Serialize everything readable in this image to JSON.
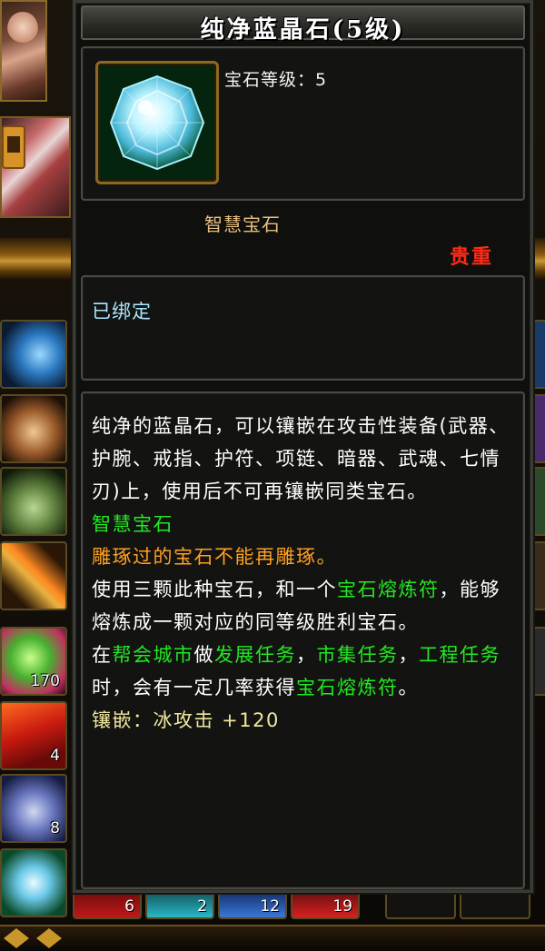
{
  "item": {
    "title": "纯净蓝晶石(5级)",
    "level_text": "宝石等级：5",
    "gem_type": "智慧宝石",
    "rarity": "贵重",
    "bound": "已绑定",
    "icon": "blue-crystal-gem-icon"
  },
  "description": {
    "p1": "纯净的蓝晶石，可以镶嵌在攻击性装备(武器、护腕、戒指、护符、项链、暗器、武魂、七情刃)上，使用后不可再镶嵌同类宝石。",
    "type_line": "智慧宝石",
    "warning": "雕琢过的宝石不能再雕琢。",
    "p3_a": "使用三颗此种宝石，和一个",
    "p3_link": "宝石熔炼符",
    "p3_b": "，能够熔炼成一颗对应的同等级胜利宝石。",
    "p4_a": "在",
    "p4_city": "帮会城市",
    "p4_b": "做",
    "p4_task1": "发展任务",
    "p4_c": "，",
    "p4_task2": "市集任务",
    "p4_d": "，",
    "p4_task3": "工程任务",
    "p4_e": "时，会有一定几率获得",
    "p4_reward": "宝石熔炼符",
    "p4_f": "。",
    "inlay_label": "镶嵌：",
    "inlay_value": "冰攻击 +120"
  },
  "background": {
    "inventory_counts": [
      "170",
      "4",
      "8"
    ],
    "bottom_counts": [
      "6",
      "2",
      "12",
      "19"
    ]
  },
  "colors": {
    "title": "#ffffff",
    "rarity": "#ff2a18",
    "bound": "#a8e8ff",
    "gem_type": "#e8c080",
    "green": "#22e822",
    "orange": "#ffa020",
    "inlay": "#f0e6a0"
  }
}
